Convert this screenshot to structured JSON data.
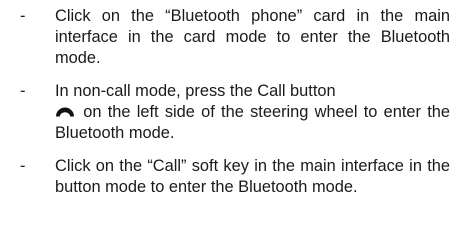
{
  "bullet_marker": "-",
  "items": [
    {
      "text": "Click on the “Bluetooth phone” card in the main interface in the card mode to enter the Bluetooth mode."
    },
    {
      "text_before_icon": "In non-call mode, press the Call button",
      "icon": "phone-handset-icon",
      "text_after_icon": "on the left side of the steering wheel to enter the Bluetooth mode."
    },
    {
      "text": "Click on the “Call” soft key in the main interface in the button mode to enter the Bluetooth mode."
    }
  ]
}
